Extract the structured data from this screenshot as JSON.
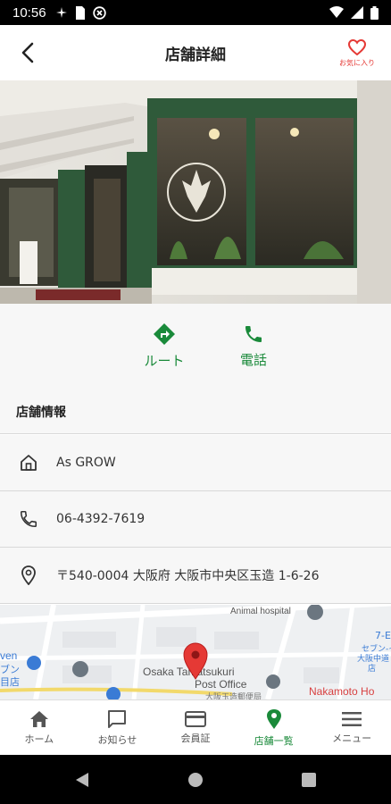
{
  "status_bar": {
    "time": "10:56"
  },
  "header": {
    "title": "店舗詳細",
    "favorite_label": "お気に入り"
  },
  "actions": [
    {
      "label": "ルート",
      "icon": "directions-icon"
    },
    {
      "label": "電話",
      "icon": "phone-icon"
    }
  ],
  "store_info": {
    "section_title": "店舗情報",
    "name": "As GROW",
    "phone": "06-4392-7619",
    "address": "〒540-0004 大阪府 大阪市中央区玉造 1-6-26"
  },
  "map": {
    "labels": {
      "animal": "Animal hospital",
      "post1": "Osaka Tamatsukuri",
      "post2": "Post Office",
      "post3": "大阪玉造郵便局",
      "nakamoto": "Nakamoto Ho",
      "seven1": "7-E",
      "seven2": "セブン-イ",
      "seven3": "大阪中道",
      "seven4": "店",
      "left1": "ven",
      "left2": "ブン",
      "left3": "目店"
    }
  },
  "tabs": [
    {
      "label": "ホーム",
      "active": false
    },
    {
      "label": "お知らせ",
      "active": false
    },
    {
      "label": "会員証",
      "active": false
    },
    {
      "label": "店舗一覧",
      "active": true
    },
    {
      "label": "メニュー",
      "active": false
    }
  ],
  "colors": {
    "accent": "#1a8a3a",
    "favorite": "#e53935",
    "store_green": "#2f5a3a"
  }
}
